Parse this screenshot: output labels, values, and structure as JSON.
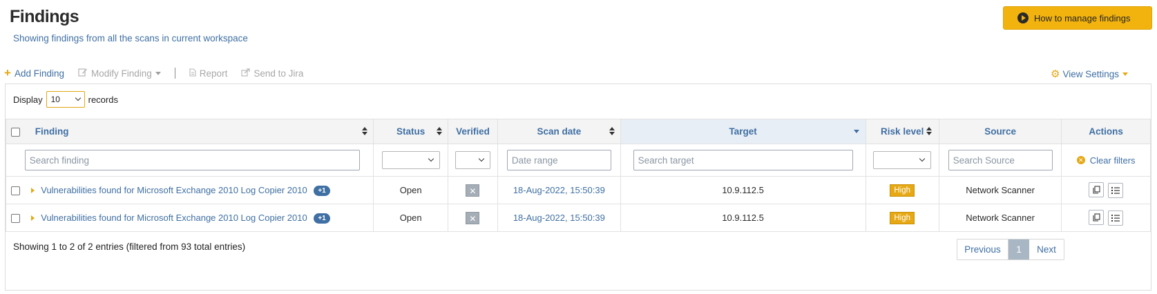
{
  "header": {
    "title": "Findings",
    "subtitle": "Showing findings from all the scans in current workspace",
    "howto_label": "How to manage findings"
  },
  "toolbar": {
    "add_label": "Add Finding",
    "modify_label": "Modify Finding",
    "report_label": "Report",
    "jira_label": "Send to Jira",
    "view_settings_label": "View Settings"
  },
  "length": {
    "prefix": "Display",
    "value": "10",
    "suffix": "records"
  },
  "table": {
    "columns": {
      "finding": "Finding",
      "status": "Status",
      "verified": "Verified",
      "scan_date": "Scan date",
      "target": "Target",
      "risk": "Risk level",
      "source": "Source",
      "actions": "Actions"
    },
    "filters": {
      "finding_placeholder": "Search finding",
      "date_placeholder": "Date range",
      "target_placeholder": "Search target",
      "source_placeholder": "Search Source",
      "clear_label": "Clear filters"
    },
    "rows": [
      {
        "finding": "Vulnerabilities found for Microsoft Exchange 2010 Log Copier 2010",
        "badge": "+1",
        "status": "Open",
        "verified": "✕",
        "scan_date": "18-Aug-2022, 15:50:39",
        "target": "10.9.112.5",
        "risk": "High",
        "source": "Network Scanner"
      },
      {
        "finding": "Vulnerabilities found for Microsoft Exchange 2010 Log Copier 2010",
        "badge": "+1",
        "status": "Open",
        "verified": "✕",
        "scan_date": "18-Aug-2022, 15:50:39",
        "target": "10.9.112.5",
        "risk": "High",
        "source": "Network Scanner"
      }
    ]
  },
  "footer": {
    "info": "Showing 1 to 2 of 2 entries (filtered from 93 total entries)",
    "prev_label": "Previous",
    "current_page": "1",
    "next_label": "Next"
  },
  "colors": {
    "accent": "#f2b30f",
    "link": "#3f6fa3",
    "risk_high": "#e6a814"
  }
}
